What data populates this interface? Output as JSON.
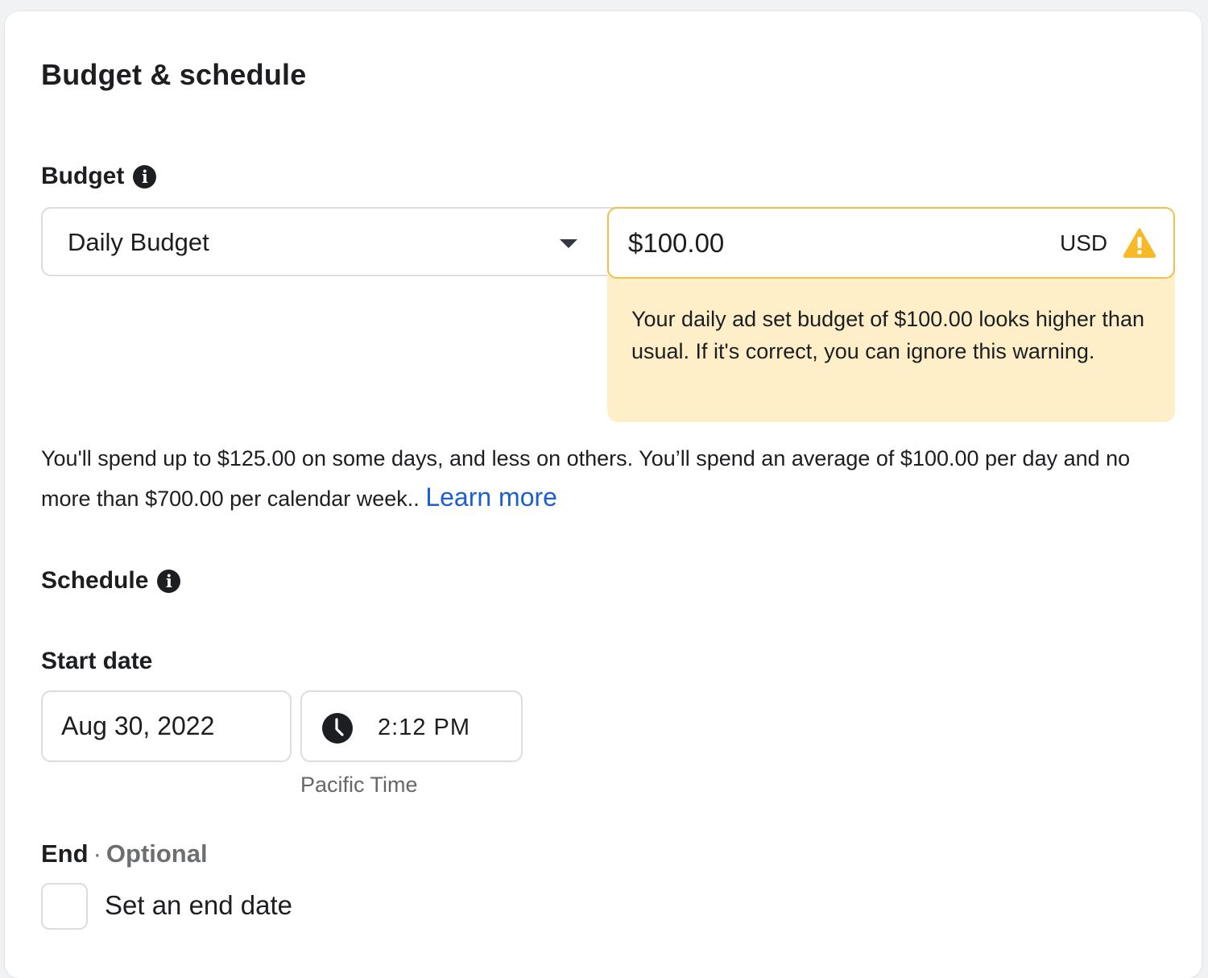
{
  "section": {
    "title": "Budget & schedule"
  },
  "budget": {
    "label": "Budget",
    "info_icon": "info-icon",
    "type_select": {
      "value": "Daily Budget",
      "icon": "caret-down-icon"
    },
    "amount": {
      "value": "$100.00",
      "currency": "USD",
      "status_icon": "warning-icon"
    },
    "warning_message": "Your daily ad set budget of $100.00 looks higher than usual. If it's correct, you can ignore this warning.",
    "spend_info": "You'll spend up to $125.00 on some days, and less on others. You’ll spend an average of $100.00 per day and no more than $700.00 per calendar week.. ",
    "learn_more_label": "Learn more"
  },
  "schedule": {
    "label": "Schedule",
    "info_icon": "info-icon",
    "start_date": {
      "label": "Start date",
      "date": "Aug 30, 2022",
      "time": "2:12 PM",
      "time_icon": "clock-icon",
      "timezone": "Pacific Time"
    },
    "end": {
      "label": "End",
      "separator": "·",
      "optional_label": "Optional",
      "checkbox_label": "Set an end date",
      "checked": false
    }
  },
  "colors": {
    "warning_border": "#f5be4a",
    "warning_background": "#feefc8",
    "warning_icon": "#f7b928",
    "link": "#1b5fd1"
  }
}
